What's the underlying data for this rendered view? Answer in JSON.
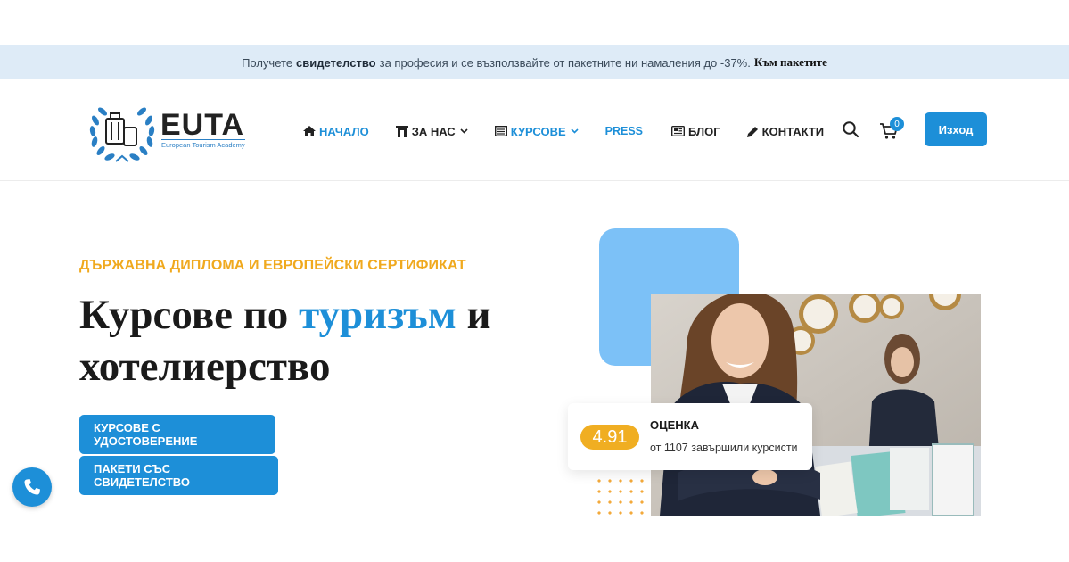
{
  "promo": {
    "text_before": "Получете",
    "text_bold": "свидетелство",
    "text_after": "за професия и се възползвайте от пакетните ни намаления до -37%.",
    "link_label": "Към пакетите"
  },
  "logo": {
    "title": "EUTA",
    "subtitle": "European Tourism Academy"
  },
  "nav": {
    "items": [
      {
        "label": "НАЧАЛО",
        "icon": "home-icon"
      },
      {
        "label": "ЗА НАС",
        "icon": "building-icon"
      },
      {
        "label": "КУРСОВЕ",
        "icon": "list-icon"
      },
      {
        "label": "PRESS"
      },
      {
        "label": "БЛОГ",
        "icon": "newspaper-icon"
      },
      {
        "label": "КОНТАКТИ",
        "icon": "pencil-icon"
      }
    ]
  },
  "header": {
    "cart_count": "0",
    "logout_label": "Изход"
  },
  "hero": {
    "eyebrow": "ДЪРЖАВНА ДИПЛОМА И ЕВРОПЕЙСКИ СЕРТИФИКАТ",
    "title_part1": "Курсове по",
    "title_accent": "туризъм",
    "title_part2": "и хотелиерство",
    "cta_primary": "КУРСОВЕ С УДОСТОВЕРЕНИЕ",
    "cta_secondary": "ПАКЕТИ СЪС СВИДЕТЕЛСТВО"
  },
  "rating": {
    "value": "4.91",
    "title": "ОЦЕНКА",
    "subtitle": "от 1107 завършили курсисти"
  },
  "colors": {
    "primary": "#1d8fd8",
    "accent_orange": "#f0a91e",
    "promo_bg": "#deebf7",
    "blue_square": "#7cc1f7"
  }
}
